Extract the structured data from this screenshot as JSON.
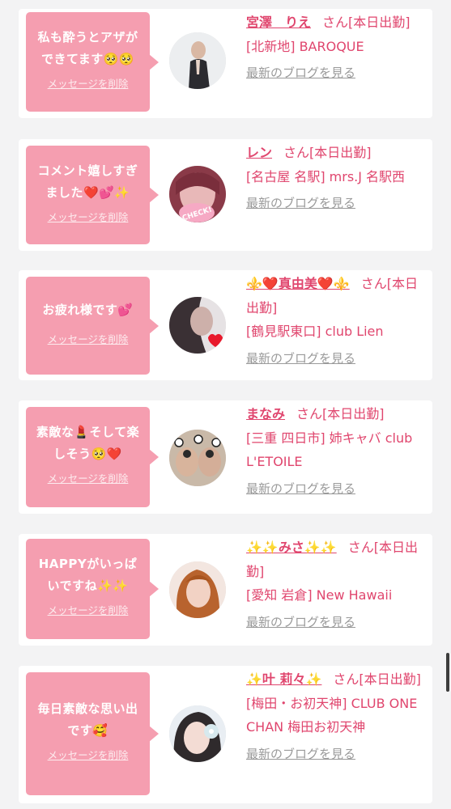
{
  "colors": {
    "background": "#f3f3f4",
    "card": "#ffffff",
    "bubble": "#f59eb0",
    "accent": "#e0466e",
    "link_gray": "#9a9a9a"
  },
  "cards": [
    {
      "message": "私も酔うとアザができてます🥺🥺",
      "delete_label": "メッセージを削除",
      "name": "宮澤　りえ",
      "status": "さん[本日出勤]",
      "shop": "[北新地] BAROQUE",
      "blog_label": "最新のブログを見る",
      "avatar_icon": "avatar-photo"
    },
    {
      "message": "コメント嬉しすぎました❤️💕✨",
      "delete_label": "メッセージを削除",
      "name": "レン",
      "status": "さん[本日出勤]",
      "shop": "[名古屋 名駅] mrs.J 名駅西",
      "blog_label": "最新のブログを見る",
      "avatar_icon": "avatar-photo-check"
    },
    {
      "message": "お疲れ様です💕",
      "delete_label": "メッセージを削除",
      "name": "⚜️❤️真由美❤️⚜️",
      "status": "さん[本日出勤]",
      "shop": "[鶴見駅東口] club Lien",
      "blog_label": "最新のブログを見る",
      "avatar_icon": "avatar-photo-heart"
    },
    {
      "message": "素敵な💄そして楽しそう🥺❤️",
      "delete_label": "メッセージを削除",
      "name": "まなみ",
      "status": "さん[本日出勤]",
      "shop": "[三重 四日市] 姉キャバ club L'ETOILE",
      "blog_label": "最新のブログを見る",
      "avatar_icon": "avatar-photo-panda"
    },
    {
      "message": "HAPPYがいっぱいですね✨✨",
      "delete_label": "メッセージを削除",
      "name": "✨✨みさ✨✨",
      "status": "さん[本日出勤]",
      "shop": "[愛知 岩倉] New Hawaii",
      "blog_label": "最新のブログを見る",
      "avatar_icon": "avatar-photo"
    },
    {
      "message": "毎日素敵な思い出です🥰",
      "delete_label": "メッセージを削除",
      "name": "✨叶 莉々✨",
      "status": "さん[本日出勤]",
      "shop": "[梅田・お初天神] CLUB ONE CHAN 梅田お初天神",
      "blog_label": "最新のブログを見る",
      "avatar_icon": "avatar-photo-flower"
    }
  ]
}
